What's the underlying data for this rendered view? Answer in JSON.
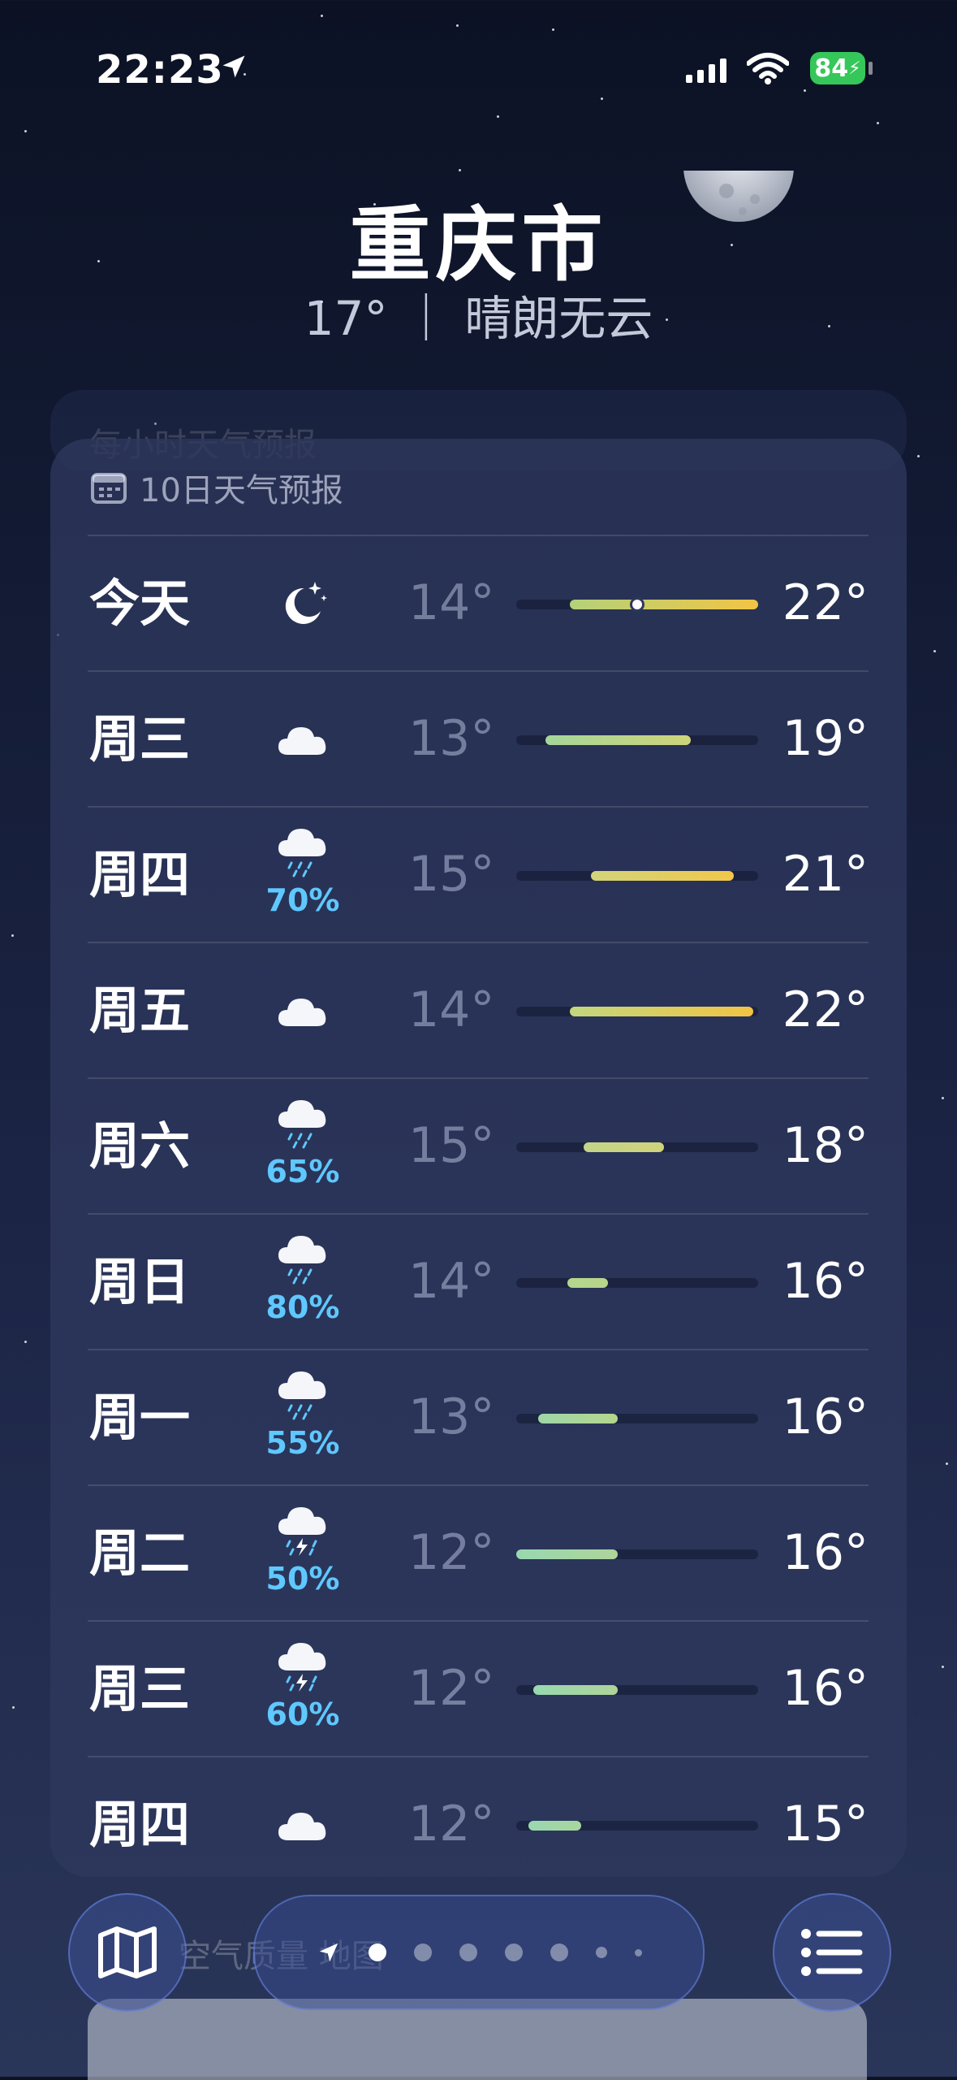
{
  "status_bar": {
    "time": "22:23",
    "battery": "84"
  },
  "location": {
    "city": "重庆市",
    "current": "17° ｜ 晴朗无云"
  },
  "forecast": {
    "ghost_title": "每小时天气预报",
    "title": "10日天气预报",
    "days": [
      {
        "day": "今天",
        "icon": "moon-stars-icon",
        "precip": "",
        "low": "14°",
        "high": "22°",
        "bar_start": 0.22,
        "bar_end": 1.0,
        "current_marker": 0.5,
        "bar_colors": [
          "#b4d27a",
          "#f2c444"
        ]
      },
      {
        "day": "周三",
        "icon": "cloud-icon",
        "precip": "",
        "low": "13°",
        "high": "19°",
        "bar_start": 0.12,
        "bar_end": 0.72,
        "bar_colors": [
          "#a5d69a",
          "#cfd47a"
        ]
      },
      {
        "day": "周四",
        "icon": "cloud-rain-icon",
        "precip": "70%",
        "low": "15°",
        "high": "21°",
        "bar_start": 0.31,
        "bar_end": 0.9,
        "bar_colors": [
          "#d3d47a",
          "#f0c84a"
        ]
      },
      {
        "day": "周五",
        "icon": "cloud-icon",
        "precip": "",
        "low": "14°",
        "high": "22°",
        "bar_start": 0.22,
        "bar_end": 0.98,
        "bar_colors": [
          "#c2d67e",
          "#f2c444"
        ]
      },
      {
        "day": "周六",
        "icon": "cloud-rain-icon",
        "precip": "65%",
        "low": "15°",
        "high": "18°",
        "bar_start": 0.28,
        "bar_end": 0.61,
        "bar_colors": [
          "#c4d48a",
          "#cfd47a"
        ]
      },
      {
        "day": "周日",
        "icon": "cloud-rain-icon",
        "precip": "80%",
        "low": "14°",
        "high": "16°",
        "bar_start": 0.21,
        "bar_end": 0.38,
        "bar_colors": [
          "#b4d68e",
          "#b8d58a"
        ]
      },
      {
        "day": "周一",
        "icon": "cloud-rain-icon",
        "precip": "55%",
        "low": "13°",
        "high": "16°",
        "bar_start": 0.09,
        "bar_end": 0.42,
        "bar_colors": [
          "#9fd6a8",
          "#b4d68e"
        ]
      },
      {
        "day": "周二",
        "icon": "cloud-storm-icon",
        "precip": "50%",
        "low": "12°",
        "high": "16°",
        "bar_start": 0.0,
        "bar_end": 0.42,
        "bar_colors": [
          "#98d8b0",
          "#aed49a"
        ]
      },
      {
        "day": "周三",
        "icon": "cloud-storm-icon",
        "precip": "60%",
        "low": "12°",
        "high": "16°",
        "bar_start": 0.07,
        "bar_end": 0.42,
        "bar_colors": [
          "#98d8b0",
          "#aed49a"
        ]
      },
      {
        "day": "周四",
        "icon": "cloud-icon",
        "precip": "",
        "low": "12°",
        "high": "15°",
        "bar_start": 0.05,
        "bar_end": 0.27,
        "bar_colors": [
          "#98d8b0",
          "#a8d69e"
        ]
      }
    ]
  },
  "bottom": {
    "air_quality_ghost": "空气质量 地图"
  },
  "pager": {
    "count": 7,
    "active": 0
  },
  "colors": {
    "precip": "#5fc8ff",
    "battery": "#35c759"
  }
}
